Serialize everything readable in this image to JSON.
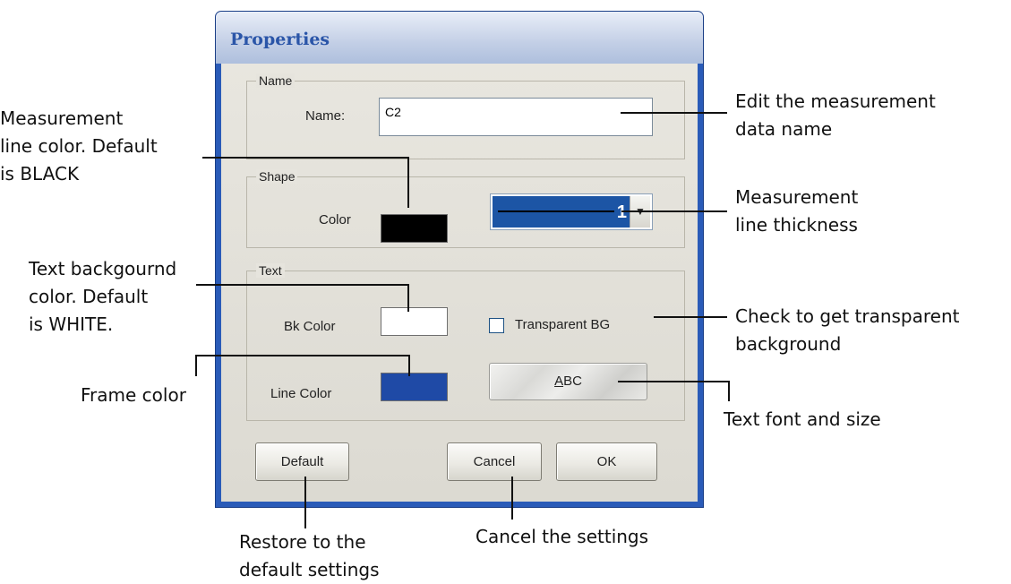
{
  "dialog": {
    "title": "Properties",
    "colors": {
      "frame": "#2a5bb8",
      "client": "#ece9d8",
      "accent": "#1c55a5"
    }
  },
  "name_group": {
    "label": "Name",
    "field_label": "Name:",
    "field_value": "C2"
  },
  "shape_group": {
    "label": "Shape",
    "color_label": "Color",
    "color_value": "#000000",
    "thickness_value": "1",
    "thickness_arrow_icon": "chevron-down-icon"
  },
  "text_group": {
    "label": "Text",
    "bk_color_label": "Bk Color",
    "bk_color_value": "#ffffff",
    "transparent_label": "Transparent BG",
    "transparent_checked": false,
    "line_color_label": "Line Color",
    "line_color_value": "#1f4aa6",
    "font_button_label": "ABC"
  },
  "buttons": {
    "default": "Default",
    "cancel": "Cancel",
    "ok": "OK"
  },
  "annotations": {
    "edit_name": [
      "Edit the measurement",
      "data name"
    ],
    "line_color": [
      "Measurement",
      "line color. Default",
      "is BLACK"
    ],
    "thickness": [
      "Measurement",
      "line thickness"
    ],
    "bk_color": [
      "Text backgournd",
      "color. Default",
      "is WHITE."
    ],
    "transparent": [
      "Check to get transparent",
      "background"
    ],
    "frame_color": "Frame color",
    "font_size": "Text font and size",
    "restore": [
      "Restore to the",
      "default settings"
    ],
    "cancel": "Cancel  the settings"
  }
}
